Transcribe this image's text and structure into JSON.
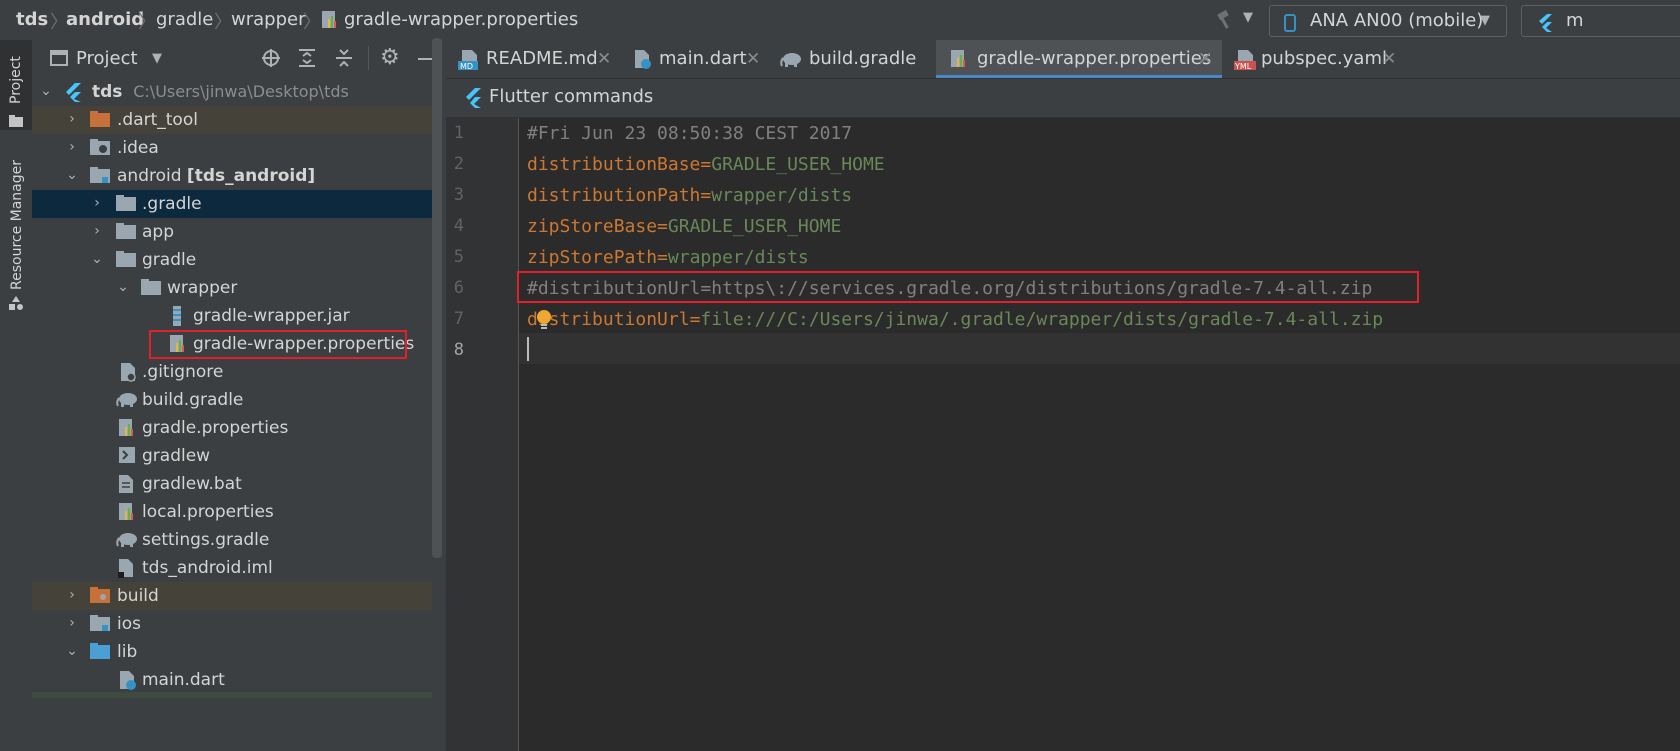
{
  "breadcrumb": {
    "items": [
      "tds",
      "android",
      "gradle",
      "wrapper",
      "gradle-wrapper.properties"
    ]
  },
  "toolbar": {
    "device_selector": "ANA AN00 (mobile)",
    "run_config_partial": "m"
  },
  "tool_strip": {
    "project_label": "Project",
    "resource_manager_label": "Resource Manager"
  },
  "project_panel": {
    "title": "Project",
    "root": {
      "name": "tds",
      "path": "C:\\Users\\jinwa\\Desktop\\tds"
    },
    "items": [
      {
        "label": ".dart_tool"
      },
      {
        "label": ".idea"
      },
      {
        "label": "android",
        "module": "[tds_android]"
      },
      {
        "label": ".gradle"
      },
      {
        "label": "app"
      },
      {
        "label": "gradle"
      },
      {
        "label": "wrapper"
      },
      {
        "label": "gradle-wrapper.jar"
      },
      {
        "label": "gradle-wrapper.properties"
      },
      {
        "label": ".gitignore"
      },
      {
        "label": "build.gradle"
      },
      {
        "label": "gradle.properties"
      },
      {
        "label": "gradlew"
      },
      {
        "label": "gradlew.bat"
      },
      {
        "label": "local.properties"
      },
      {
        "label": "settings.gradle"
      },
      {
        "label": "tds_android.iml"
      },
      {
        "label": "build"
      },
      {
        "label": "ios"
      },
      {
        "label": "lib"
      },
      {
        "label": "main.dart"
      }
    ]
  },
  "tabs": [
    {
      "label": "README.md",
      "icon": "markdown-icon"
    },
    {
      "label": "main.dart",
      "icon": "dart-file-icon"
    },
    {
      "label": "build.gradle",
      "icon": "gradle-elephant-icon"
    },
    {
      "label": "gradle-wrapper.properties",
      "icon": "properties-file-icon",
      "active": true
    },
    {
      "label": "pubspec.yaml",
      "icon": "yaml-icon"
    }
  ],
  "notification": {
    "label": "Flutter commands"
  },
  "editor": {
    "line_numbers": [
      "1",
      "2",
      "3",
      "4",
      "5",
      "6",
      "7",
      "8"
    ],
    "lines": [
      {
        "comment": "#Fri Jun 23 08:50:38 CEST 2017"
      },
      {
        "key": "distributionBase",
        "eq": "=",
        "value": "GRADLE_USER_HOME"
      },
      {
        "key": "distributionPath",
        "eq": "=",
        "value": "wrapper/dists"
      },
      {
        "key": "zipStoreBase",
        "eq": "=",
        "value": "GRADLE_USER_HOME"
      },
      {
        "key": "zipStorePath",
        "eq": "=",
        "value": "wrapper/dists"
      },
      {
        "comment": "#distributionUrl=https\\://services.gradle.org/distributions/gradle-7.4-all.zip"
      },
      {
        "key": "distributionUrl",
        "eq": "=",
        "value": "file:///C:/Users/jinwa/.gradle/wrapper/dists/gradle-7.4-all.zip"
      },
      {
        "comment": ""
      }
    ]
  },
  "colors": {
    "key": "#cc7832",
    "value": "#6a8759",
    "comment": "#808080",
    "highlight_box": "#e0202a",
    "accent": "#4a88c7"
  }
}
